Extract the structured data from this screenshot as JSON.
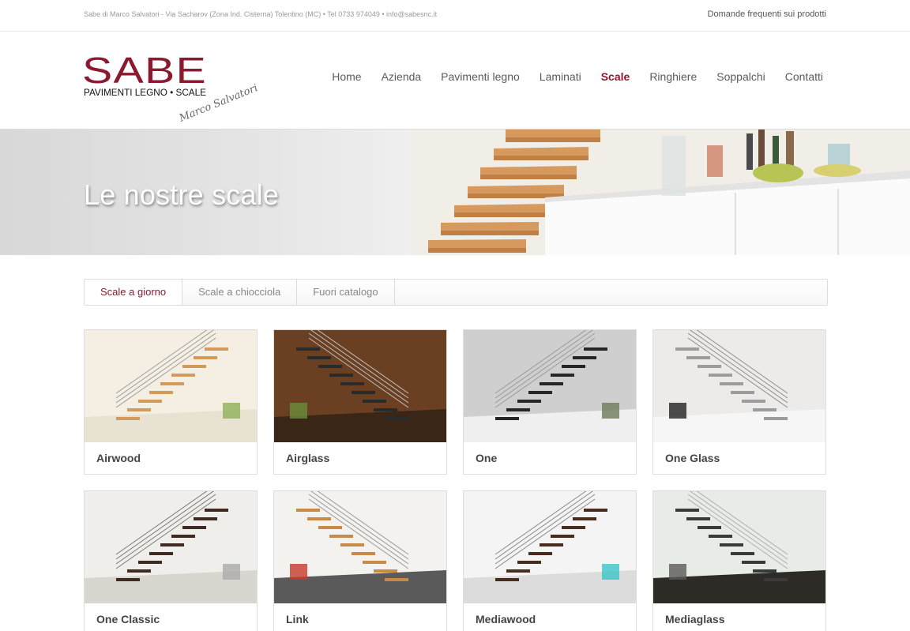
{
  "topbar": {
    "info": "Sabe di Marco Salvatori - Via Sacharov (Zona Ind. Cisterna) Tolentino (MC) • Tel 0733 974049 • info@sabesnc.it",
    "faq_link": "Domande frequenti sui prodotti"
  },
  "logo": {
    "brand": "SABE",
    "tagline": "PAVIMENTI LEGNO • SCALE",
    "signature": "Marco Salvatori",
    "brand_color": "#8b1a2e"
  },
  "nav": {
    "items": [
      {
        "label": "Home",
        "active": false
      },
      {
        "label": "Azienda",
        "active": false
      },
      {
        "label": "Pavimenti legno",
        "active": false
      },
      {
        "label": "Laminati",
        "active": false
      },
      {
        "label": "Scale",
        "active": true
      },
      {
        "label": "Ringhiere",
        "active": false
      },
      {
        "label": "Soppalchi",
        "active": false
      },
      {
        "label": "Contatti",
        "active": false
      }
    ],
    "accent_color": "#8b1a2e"
  },
  "hero": {
    "title": "Le nostre scale"
  },
  "tabs": [
    {
      "label": "Scale a giorno",
      "active": true
    },
    {
      "label": "Scale a chiocciola",
      "active": false
    },
    {
      "label": "Fuori catalogo",
      "active": false
    }
  ],
  "products": [
    {
      "name": "Airwood",
      "image": "airwood-staircase-photo"
    },
    {
      "name": "Airglass",
      "image": "airglass-staircase-photo"
    },
    {
      "name": "One",
      "image": "one-staircase-photo"
    },
    {
      "name": "One Glass",
      "image": "one-glass-staircase-photo"
    },
    {
      "name": "One Classic",
      "image": "one-classic-staircase-photo"
    },
    {
      "name": "Link",
      "image": "link-staircase-photo"
    },
    {
      "name": "Mediawood",
      "image": "mediawood-staircase-photo"
    },
    {
      "name": "Mediaglass",
      "image": "mediaglass-staircase-photo"
    }
  ]
}
